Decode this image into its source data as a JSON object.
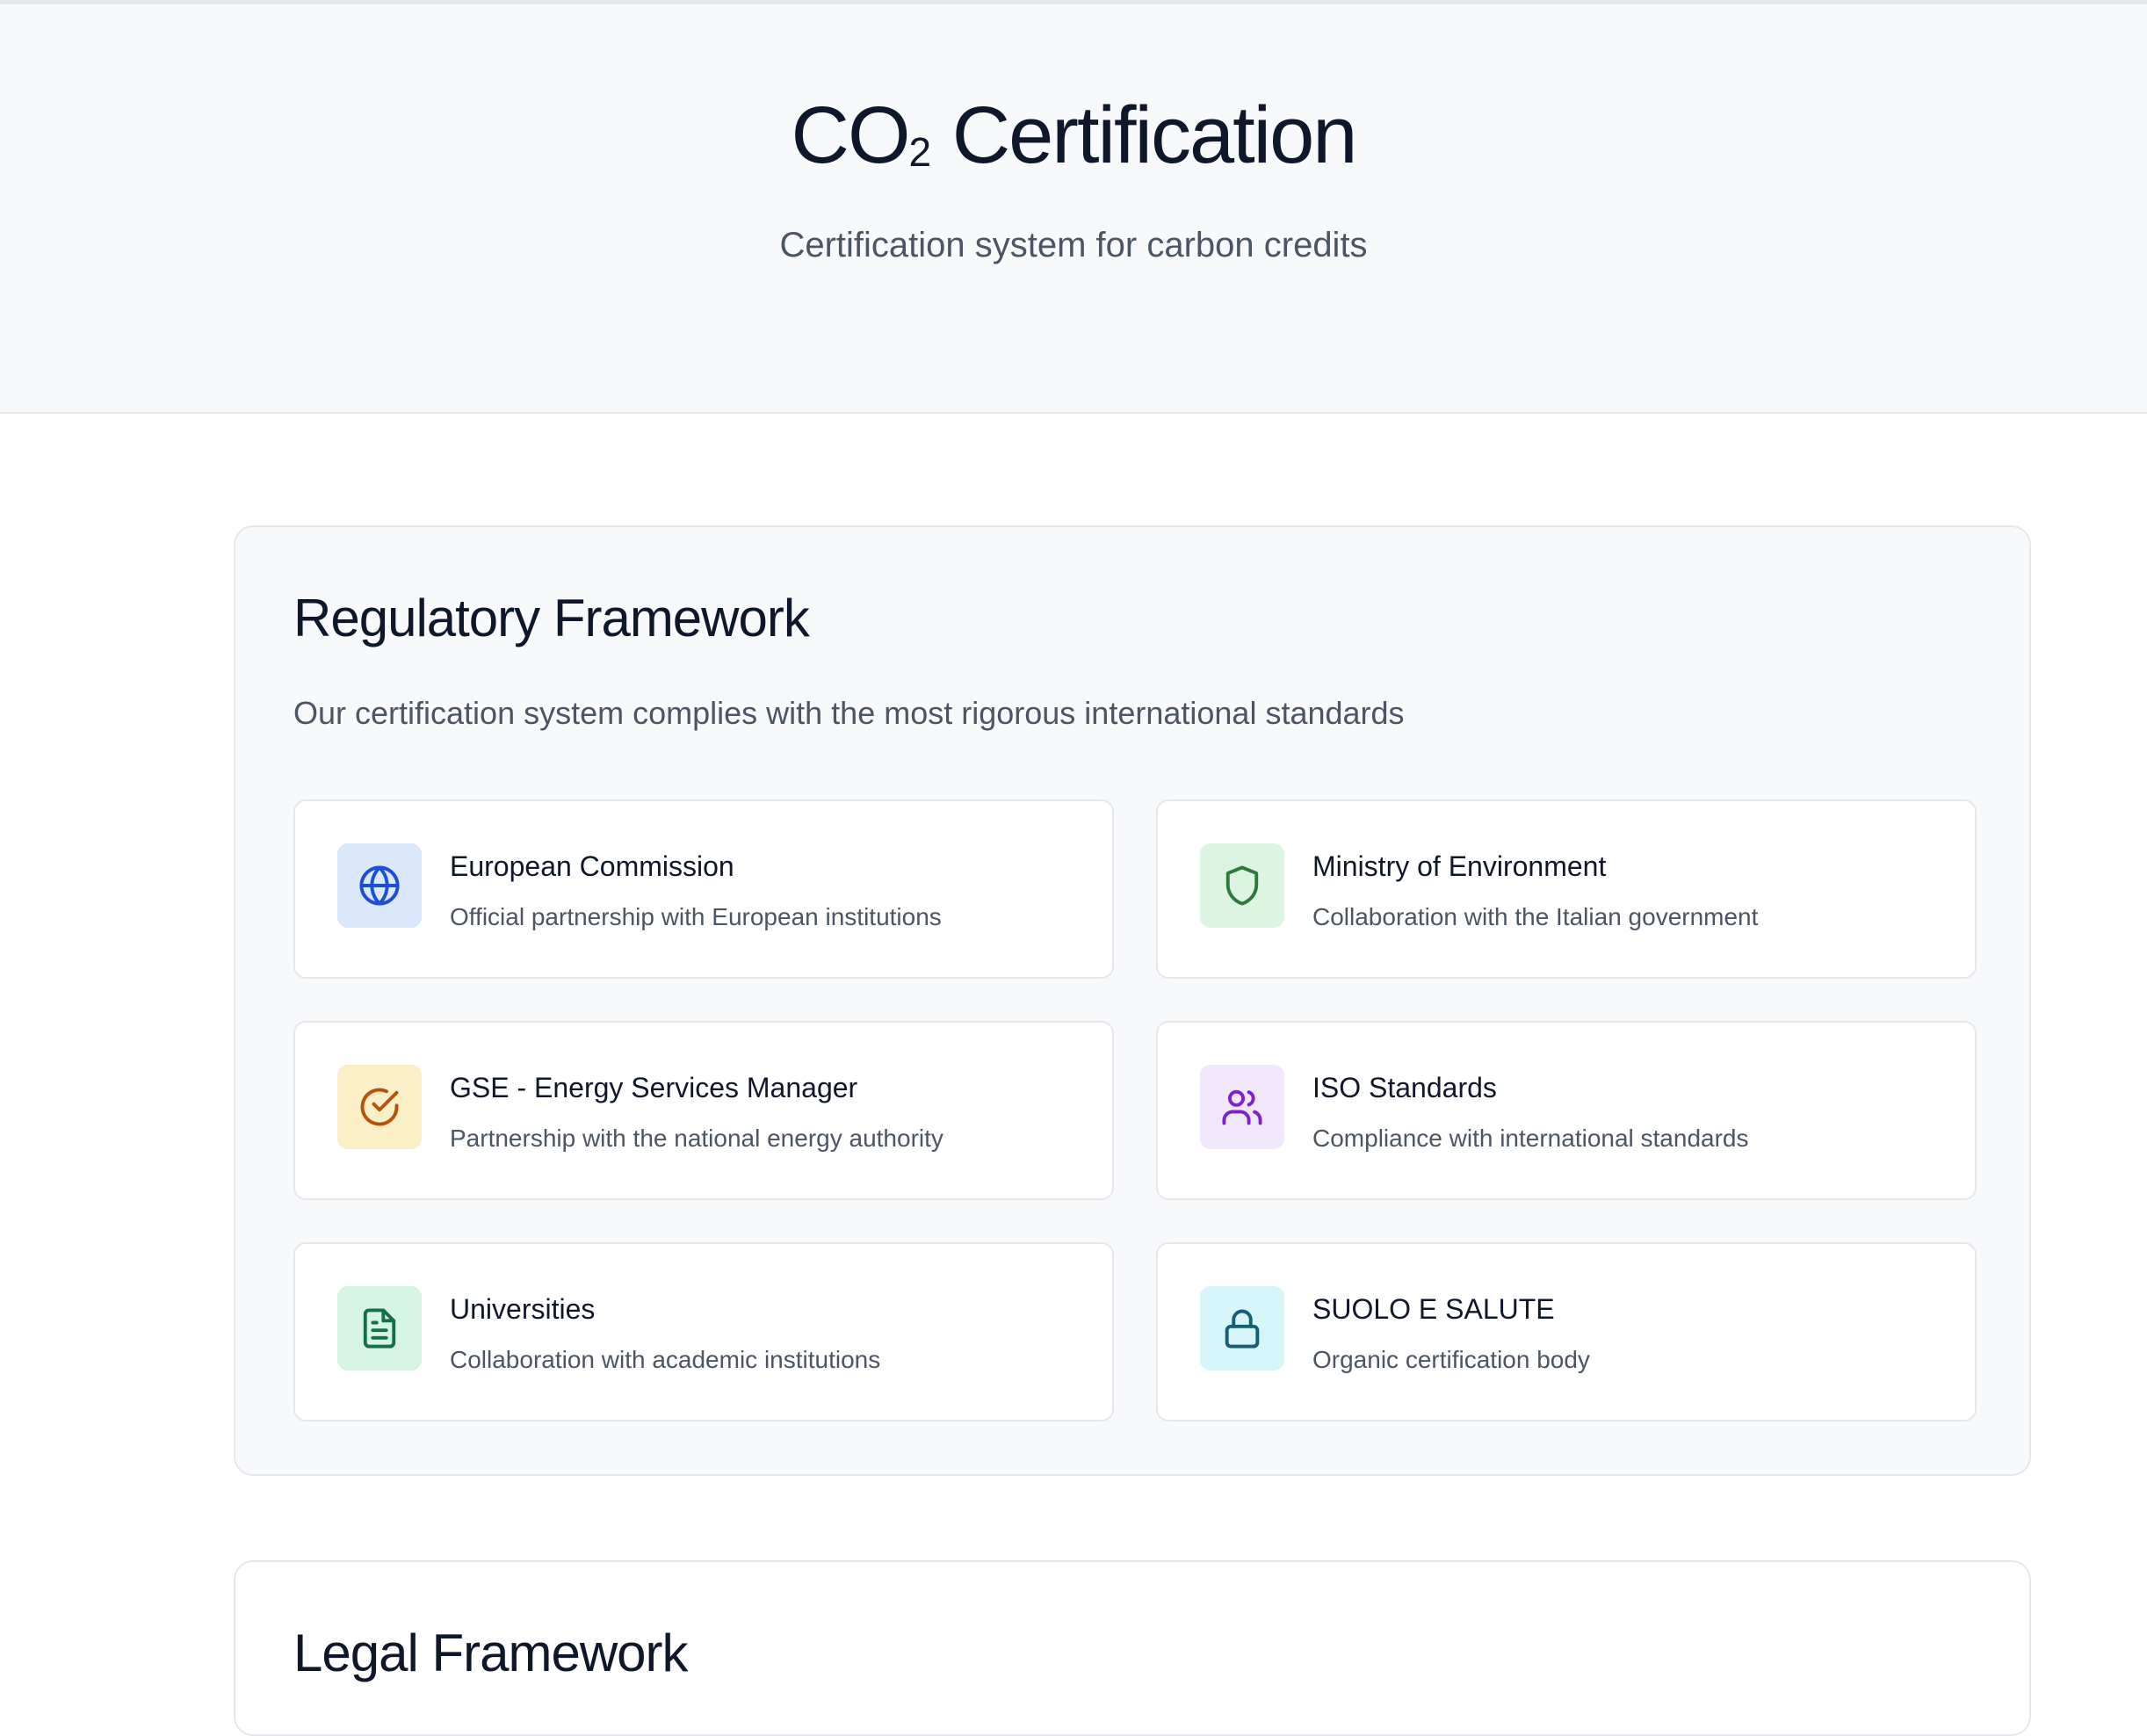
{
  "hero": {
    "title_main": "CO",
    "title_sub": "2",
    "title_rest": " Certification",
    "subtitle": "Certification system for carbon credits"
  },
  "regulatory": {
    "title": "Regulatory Framework",
    "description": "Our certification system complies with the most rigorous international standards",
    "cards": [
      {
        "title": "European Commission",
        "desc": "Official partnership with European institutions",
        "icon": "globe-icon",
        "bg": "#dbe7fb",
        "fg": "#1d4ed8"
      },
      {
        "title": "Ministry of Environment",
        "desc": "Collaboration with the Italian government",
        "icon": "shield-icon",
        "bg": "#dcf5e3",
        "fg": "#2f7a3a"
      },
      {
        "title": "GSE - Energy Services Manager",
        "desc": "Partnership with the national energy authority",
        "icon": "check-circle-icon",
        "bg": "#fbefc8",
        "fg": "#b45309"
      },
      {
        "title": "ISO Standards",
        "desc": "Compliance with international standards",
        "icon": "users-icon",
        "bg": "#f1e7fb",
        "fg": "#7e22ce"
      },
      {
        "title": "Universities",
        "desc": "Collaboration with academic institutions",
        "icon": "document-icon",
        "bg": "#d6f4e3",
        "fg": "#15704a"
      },
      {
        "title": "SUOLO E SALUTE",
        "desc": "Organic certification body",
        "icon": "lock-icon",
        "bg": "#d6f5f9",
        "fg": "#155e75"
      }
    ]
  },
  "legal": {
    "title": "Legal Framework"
  }
}
